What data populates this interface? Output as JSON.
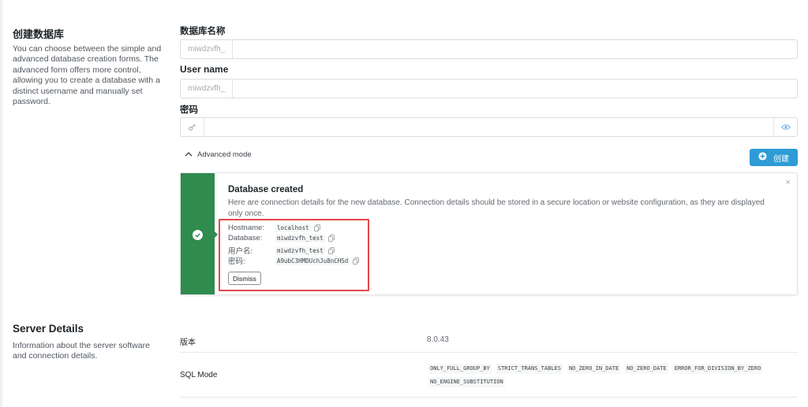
{
  "create_section": {
    "title": "创建数据库",
    "description": "You can choose between the simple and advanced database creation forms. The advanced form offers more control, allowing you to create a database with a distinct username and manually set password."
  },
  "form": {
    "db_name_label": "数据库名称",
    "db_name_prefix": "miwdzvfh_",
    "username_label": "User name",
    "username_prefix": "miwdzvfh_",
    "password_label": "密码",
    "advanced_toggle": "Advanced mode",
    "create_button": "创建"
  },
  "notice": {
    "title": "Database created",
    "text": "Here are connection details for the new database. Connection details should be stored in a secure location or website configuration, as they are displayed only once.",
    "details": [
      {
        "key": "Hostname:",
        "value": "localhost"
      },
      {
        "key": "Database:",
        "value": "miwdzvfh_test"
      },
      {
        "key": "用户名:",
        "value": "miwdzvfh_test"
      },
      {
        "key": "密码:",
        "value": "A9ubC3HMDUchJu8nCHSd"
      }
    ],
    "dismiss": "Dismiss",
    "close": "×"
  },
  "server_section": {
    "title": "Server Details",
    "description": "Information about the server software and connection details.",
    "version_label": "版本",
    "version_value": "8.0.43",
    "sql_mode_label": "SQL Mode",
    "sql_modes": [
      "ONLY_FULL_GROUP_BY",
      "STRICT_TRANS_TABLES",
      "NO_ZERO_IN_DATE",
      "NO_ZERO_DATE",
      "ERROR_FOR_DIVISION_BY_ZERO",
      "NO_ENGINE_SUBSTITUTION"
    ]
  },
  "colors": {
    "accent": "#2e9bd6",
    "success": "#2f8b4e",
    "highlight": "#e5484d"
  }
}
